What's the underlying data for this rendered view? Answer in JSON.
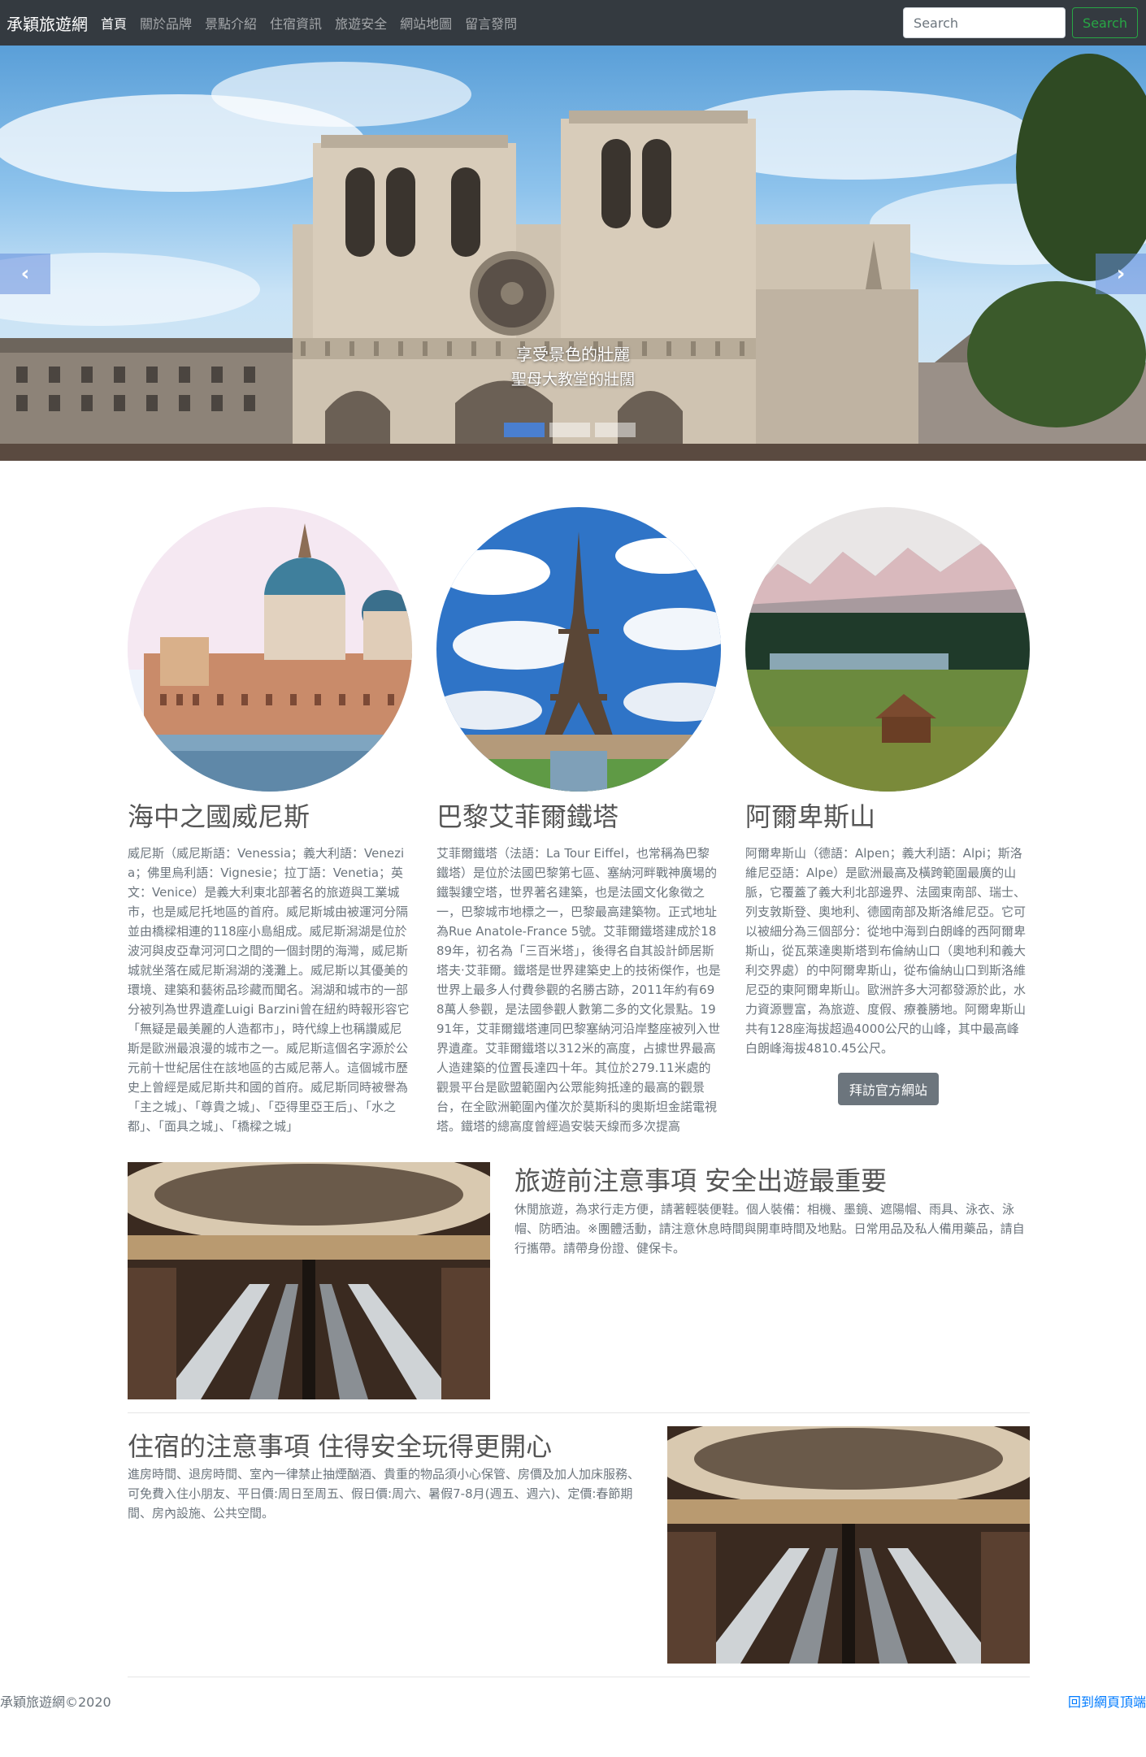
{
  "navbar": {
    "brand": "承穎旅遊網",
    "links": [
      "首頁",
      "關於品牌",
      "景點介紹",
      "住宿資訊",
      "旅遊安全",
      "網站地圖",
      "留言發問"
    ],
    "search_placeholder": "Search",
    "search_button": "Search"
  },
  "carousel": {
    "caption_title": "享受景色的壯麗",
    "caption_text": "聖母大教堂的壯闊",
    "active_index": 0,
    "slide_count": 3
  },
  "features": [
    {
      "title": "海中之國威尼斯",
      "text": "威尼斯（威尼斯語：Venessia；義大利語：Venezia；佛里烏利語：Vignesie；拉丁語：Venetia；英文：Venice）是義大利東北部著名的旅遊與工業城市，也是威尼托地區的首府。威尼斯城由被運河分隔並由橋樑相連的118座小島組成。威尼斯潟湖是位於波河與皮亞韋河河口之間的一個封閉的海灣，威尼斯城就坐落在威尼斯潟湖的淺灘上。威尼斯以其優美的環境、建築和藝術品珍藏而聞名。潟湖和城市的一部分被列為世界遺產Luigi Barzini曾在紐約時報形容它「無疑是最美麗的人造都市」，時代線上也稱讚威尼斯是歐洲最浪漫的城市之一。威尼斯這個名字源於公元前十世紀居住在該地區的古威尼蒂人。這個城市歷史上曾經是威尼斯共和國的首府。威尼斯同時被譽為「主之城」、「尊貴之城」、「亞得里亞王后」、「水之都」、「面具之城」、「橋樑之城」"
    },
    {
      "title": "巴黎艾菲爾鐵塔",
      "text": "艾菲爾鐵塔（法語：La Tour Eiffel，也常稱為巴黎鐵塔）是位於法國巴黎第七區、塞納河畔戰神廣場的鐵製鏤空塔，世界著名建築，也是法國文化象徵之一，巴黎城市地標之一，巴黎最高建築物。正式地址為Rue Anatole-France 5號。艾菲爾鐵塔建成於1889年，初名為「三百米塔」，後得名自其設計師居斯塔夫·艾菲爾。鐵塔是世界建築史上的技術傑作，也是世界上最多人付費參觀的名勝古跡，2011年約有698萬人參觀，是法國參觀人數第二多的文化景點。1991年，艾菲爾鐵塔連同巴黎塞納河沿岸整座被列入世界遺產。艾菲爾鐵塔以312米的高度，占據世界最高人造建築的位置長達四十年。其位於279.11米處的觀景平台是歐盟範圍內公眾能夠抵達的最高的觀景台，在全歐洲範圍內僅次於莫斯科的奧斯坦金諾電視塔。鐵塔的總高度曾經過安裝天線而多次提高"
    },
    {
      "title": "阿爾卑斯山",
      "text": "阿爾卑斯山（德語：Alpen；義大利語：Alpi；斯洛維尼亞語：Alpe）是歐洲最高及橫跨範圍最廣的山脈，它覆蓋了義大利北部邊界、法國東南部、瑞士、列支敦斯登、奧地利、德國南部及斯洛維尼亞。它可以被細分為三個部分：從地中海到白朗峰的西阿爾卑斯山，從瓦萊達奧斯塔到布倫納山口（奧地利和義大利交界處）的中阿爾卑斯山，從布倫納山口到斯洛維尼亞的東阿爾卑斯山。歐洲許多大河都發源於此，水力資源豐富，為旅遊、度假、療養勝地。阿爾卑斯山共有128座海拔超過4000公尺的山峰，其中最高峰白朗峰海拔4810.45公尺。",
      "button": "拜訪官方網站"
    }
  ],
  "featurettes": [
    {
      "title": "旅遊前注意事項 安全出遊最重要",
      "text": "休閒旅遊，為求行走方便，請著輕裝便鞋。個人裝備：相機、墨鏡、遮陽帽、雨具、泳衣、泳帽、防晒油。※團體活動，請注意休息時間與開車時間及地點。日常用品及私人備用藥品，請自行攜帶。請帶身份證、健保卡。"
    },
    {
      "title": "住宿的注意事項 住得安全玩得更開心",
      "text": "進房時間、退房時間、室內一律禁止抽煙酗酒、貴重的物品須小心保管、房價及加人加床服務、可免費入住小朋友、平日價:周日至周五、假日價:周六、暑假7-8月(週五、週六)、定價:春節期間、房內設施、公共空間。"
    }
  ],
  "footer": {
    "copyright": "承穎旅遊網©2020",
    "back_to_top": "回到網頁頂端"
  }
}
